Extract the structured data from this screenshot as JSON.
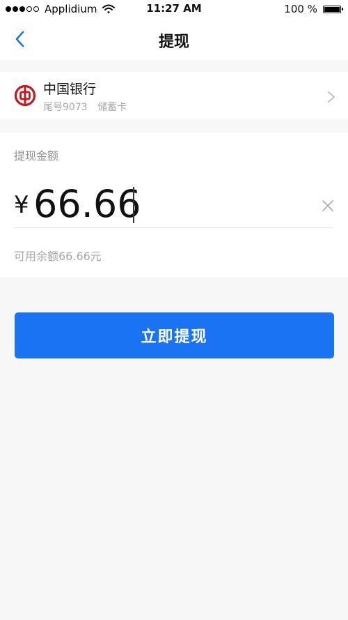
{
  "status_bar": {
    "carrier": "Applidium",
    "time": "11:27 AM",
    "battery": "100 %"
  },
  "nav": {
    "title": "提现"
  },
  "bank": {
    "name": "中国银行",
    "card_tail": "尾号9073",
    "card_type": "储蓄卡",
    "brand_color": "#c6161c"
  },
  "amount": {
    "label": "提现金额",
    "currency": "¥",
    "value": "66.66",
    "available": "可用余额66.66元"
  },
  "actions": {
    "withdraw_label": "立即提现",
    "accent_color": "#1a73f2"
  },
  "icons": {
    "back": "chevron-left-icon",
    "bank": "bank-of-china-logo-icon",
    "chevron": "chevron-right-icon",
    "clear": "close-icon",
    "wifi": "wifi-icon",
    "battery": "battery-icon"
  }
}
